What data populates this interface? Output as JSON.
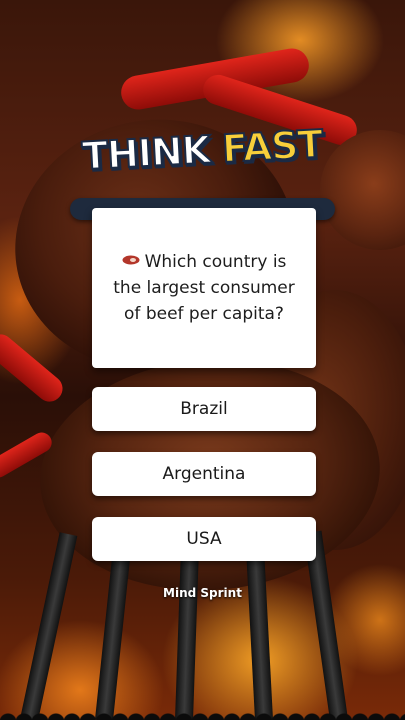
{
  "header": {
    "title_part1": "THINK",
    "title_part2": "FAST"
  },
  "question": {
    "icon": "steak-icon",
    "text": "Which country is the largest consumer of beef per capita?"
  },
  "answers": [
    {
      "label": "Brazil"
    },
    {
      "label": "Argentina"
    },
    {
      "label": "USA"
    }
  ],
  "footer": {
    "brand": "Mind Sprint"
  },
  "colors": {
    "accent_yellow": "#f8cf3a",
    "title_outline": "#1b2a44",
    "card_bg": "#ffffff"
  }
}
